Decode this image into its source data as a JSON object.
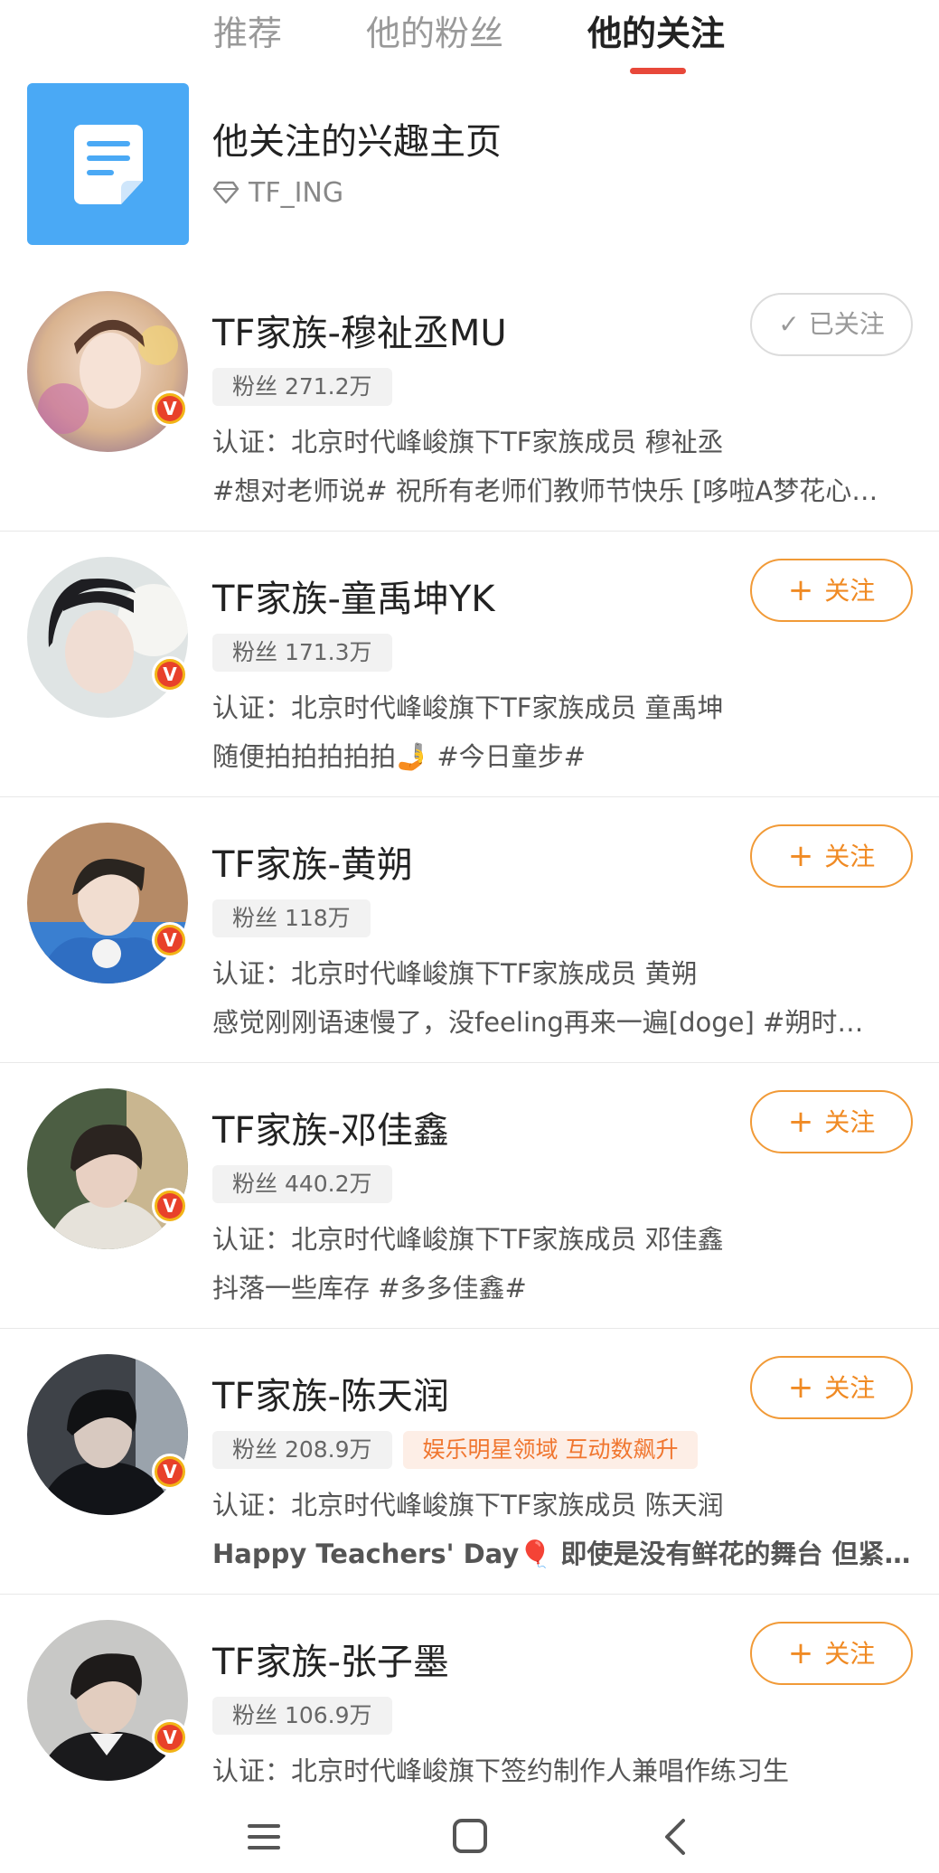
{
  "tabs": [
    {
      "label": "推荐",
      "active": false
    },
    {
      "label": "他的粉丝",
      "active": false
    },
    {
      "label": "他的关注",
      "active": true
    }
  ],
  "interest": {
    "title": "他关注的兴趣主页",
    "subtitle": "TF_ING",
    "icon": "document-icon"
  },
  "users": [
    {
      "name": "TF家族-穆祉丞MU",
      "fans": "粉丝 271.2万",
      "hot_tag": "",
      "verify": "认证：北京时代峰峻旗下TF家族成员 穆祉丞",
      "desc": "#想对老师说# 祝所有老师们教师节快乐 [哆啦A梦花心…",
      "button": "已关注",
      "followed": true
    },
    {
      "name": "TF家族-童禹坤YK",
      "fans": "粉丝 171.3万",
      "hot_tag": "",
      "verify": "认证：北京时代峰峻旗下TF家族成员 童禹坤",
      "desc": "随便拍拍拍拍拍🤳 #今日童步#",
      "button": "关注",
      "followed": false
    },
    {
      "name": "TF家族-黄朔",
      "fans": "粉丝 118万",
      "hot_tag": "",
      "verify": "认证：北京时代峰峻旗下TF家族成员 黄朔",
      "desc": "感觉刚刚语速慢了，没feeling再来一遍[doge] #朔时…",
      "button": "关注",
      "followed": false
    },
    {
      "name": "TF家族-邓佳鑫",
      "fans": "粉丝 440.2万",
      "hot_tag": "",
      "verify": "认证：北京时代峰峻旗下TF家族成员 邓佳鑫",
      "desc": "抖落一些库存 #多多佳鑫#",
      "button": "关注",
      "followed": false
    },
    {
      "name": "TF家族-陈天润",
      "fans": "粉丝 208.9万",
      "hot_tag": "娱乐明星领域 互动数飙升",
      "verify": "认证：北京时代峰峻旗下TF家族成员 陈天润",
      "desc": "Happy Teachers' Day🎈 即使是没有鲜花的舞台 但紧…",
      "button": "关注",
      "followed": false
    },
    {
      "name": "TF家族-张子墨",
      "fans": "粉丝 106.9万",
      "hot_tag": "",
      "verify": "认证：北京时代峰峻旗下签约制作人兼唱作练习生",
      "desc": "",
      "button": "关注",
      "followed": false
    }
  ],
  "colors": {
    "accent": "#f08a23",
    "tab_indicator": "#e8483a",
    "tile_blue": "#4aa9f5"
  }
}
